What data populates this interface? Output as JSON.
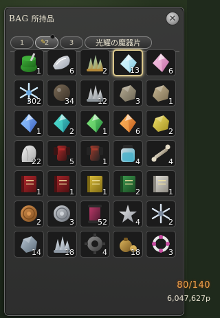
{
  "window": {
    "title": "BAG",
    "subtitle": "所持品",
    "close_label": "✕"
  },
  "tabs": [
    {
      "label": "1",
      "active": false
    },
    {
      "label": "2",
      "active": true
    },
    {
      "label": "3",
      "active": false
    }
  ],
  "crystal_tab": {
    "label": "光耀の魔器片"
  },
  "items": [
    {
      "icon": "green-potion-icon",
      "qty": "1",
      "c1": "#3fae3a",
      "c2": "#1d6b1a",
      "shape": "pot"
    },
    {
      "icon": "white-scale-icon",
      "qty": "6",
      "c1": "#f1f1f1",
      "c2": "#9aa2b0",
      "shape": "flake"
    },
    {
      "icon": "gem-cluster-icon",
      "qty": "2",
      "c1": "#9de0c8",
      "c2": "#b58a3a",
      "shape": "cluster"
    },
    {
      "icon": "light-crystal-icon",
      "qty": "13",
      "c1": "#d9f7ff",
      "c2": "#7fc8e0",
      "shape": "crystal"
    },
    {
      "icon": "pink-crystal-icon",
      "qty": "6",
      "c1": "#f5c2e2",
      "c2": "#c36aa3",
      "shape": "crystal"
    },
    {
      "icon": "ice-snowflake-icon",
      "qty": "302",
      "c1": "#d0ecff",
      "c2": "#6aa8e0",
      "shape": "snow"
    },
    {
      "icon": "dark-ore-icon",
      "qty": "34",
      "c1": "#7a6a55",
      "c2": "#3c332a",
      "shape": "orb"
    },
    {
      "icon": "white-shard-icon",
      "qty": "12",
      "c1": "#e6e6e6",
      "c2": "#8f969c",
      "shape": "cluster"
    },
    {
      "icon": "stone-ore-icon",
      "qty": "3",
      "c1": "#b7ad94",
      "c2": "#6b6453",
      "shape": "rock"
    },
    {
      "icon": "tan-ore-icon",
      "qty": "1",
      "c1": "#c9b894",
      "c2": "#7b6d52",
      "shape": "rock"
    },
    {
      "icon": "blue-crystal-icon",
      "qty": "1",
      "c1": "#8ec2ff",
      "c2": "#3a5fc0",
      "shape": "crystal"
    },
    {
      "icon": "teal-crystal-icon",
      "qty": "2",
      "c1": "#4ee0d0",
      "c2": "#1c7d8c",
      "shape": "crystal"
    },
    {
      "icon": "green-crystal-icon",
      "qty": "1",
      "c1": "#7ee67a",
      "c2": "#20883a",
      "shape": "crystal"
    },
    {
      "icon": "orange-crystal-icon",
      "qty": "6",
      "c1": "#ffb35a",
      "c2": "#c05a1a",
      "shape": "crystal"
    },
    {
      "icon": "yellow-crystal-icon",
      "qty": "2",
      "c1": "#f3e36a",
      "c2": "#a39020",
      "shape": "rock"
    },
    {
      "icon": "white-cloth-icon",
      "qty": "22",
      "c1": "#f0f0f0",
      "c2": "#a7a7a7",
      "shape": "cloth"
    },
    {
      "icon": "red-armor-icon",
      "qty": "5",
      "c1": "#b32a2a",
      "c2": "#3a1414",
      "shape": "armor"
    },
    {
      "icon": "dark-armor-icon",
      "qty": "1",
      "c1": "#a33b2c",
      "c2": "#242424",
      "shape": "armor"
    },
    {
      "icon": "potion-bottle-icon",
      "qty": "4",
      "c1": "#cfd6dc",
      "c2": "#48b0c9",
      "shape": "bottle"
    },
    {
      "icon": "bone-icon",
      "qty": "4",
      "c1": "#e2dac6",
      "c2": "#908570",
      "shape": "bone"
    },
    {
      "icon": "red-book-icon",
      "qty": "1",
      "c1": "#b7282d",
      "c2": "#5a1214",
      "shape": "book"
    },
    {
      "icon": "red-tome-icon",
      "qty": "1",
      "c1": "#a8262a",
      "c2": "#4e1012",
      "shape": "book"
    },
    {
      "icon": "yellow-book-icon",
      "qty": "1",
      "c1": "#e0c13c",
      "c2": "#7f6a13",
      "shape": "book"
    },
    {
      "icon": "green-book-icon",
      "qty": "2",
      "c1": "#3d9b4f",
      "c2": "#1a4a22",
      "shape": "book"
    },
    {
      "icon": "white-book-icon",
      "qty": "1",
      "c1": "#e6e3dc",
      "c2": "#8d8a82",
      "shape": "book"
    },
    {
      "icon": "bronze-coin-icon",
      "qty": "2",
      "c1": "#d99450",
      "c2": "#7a4a1e",
      "shape": "coin"
    },
    {
      "icon": "silver-coin-icon",
      "qty": "3",
      "c1": "#cfd3d8",
      "c2": "#6b7078",
      "shape": "coin"
    },
    {
      "icon": "red-scroll-icon",
      "qty": "52",
      "c1": "#c23a6b",
      "c2": "#4a1a30",
      "shape": "scroll"
    },
    {
      "icon": "white-star-icon",
      "qty": "4",
      "c1": "#f2f2f2",
      "c2": "#8b8f98",
      "shape": "star"
    },
    {
      "icon": "frost-flake-icon",
      "qty": "2",
      "c1": "#dbe6f2",
      "c2": "#7c8a9e",
      "shape": "snow"
    },
    {
      "icon": "stone-slab-icon",
      "qty": "14",
      "c1": "#b8c7d4",
      "c2": "#5c6b79",
      "shape": "rock"
    },
    {
      "icon": "crystal-cluster-icon",
      "qty": "18",
      "c1": "#e6ecf2",
      "c2": "#8f9aa6",
      "shape": "cluster"
    },
    {
      "icon": "gear-icon",
      "qty": "4",
      "c1": "#8e8e8e",
      "c2": "#3a3a3a",
      "shape": "gear"
    },
    {
      "icon": "coin-pouch-icon",
      "qty": "18",
      "c1": "#d9b25a",
      "c2": "#7a5a22",
      "shape": "pouch"
    },
    {
      "icon": "bead-ring-icon",
      "qty": "3",
      "c1": "#e8e8e8",
      "c2": "#c74aa0",
      "shape": "ring"
    }
  ],
  "footer": {
    "capacity": "80/140",
    "gil": "6,047,627p"
  }
}
